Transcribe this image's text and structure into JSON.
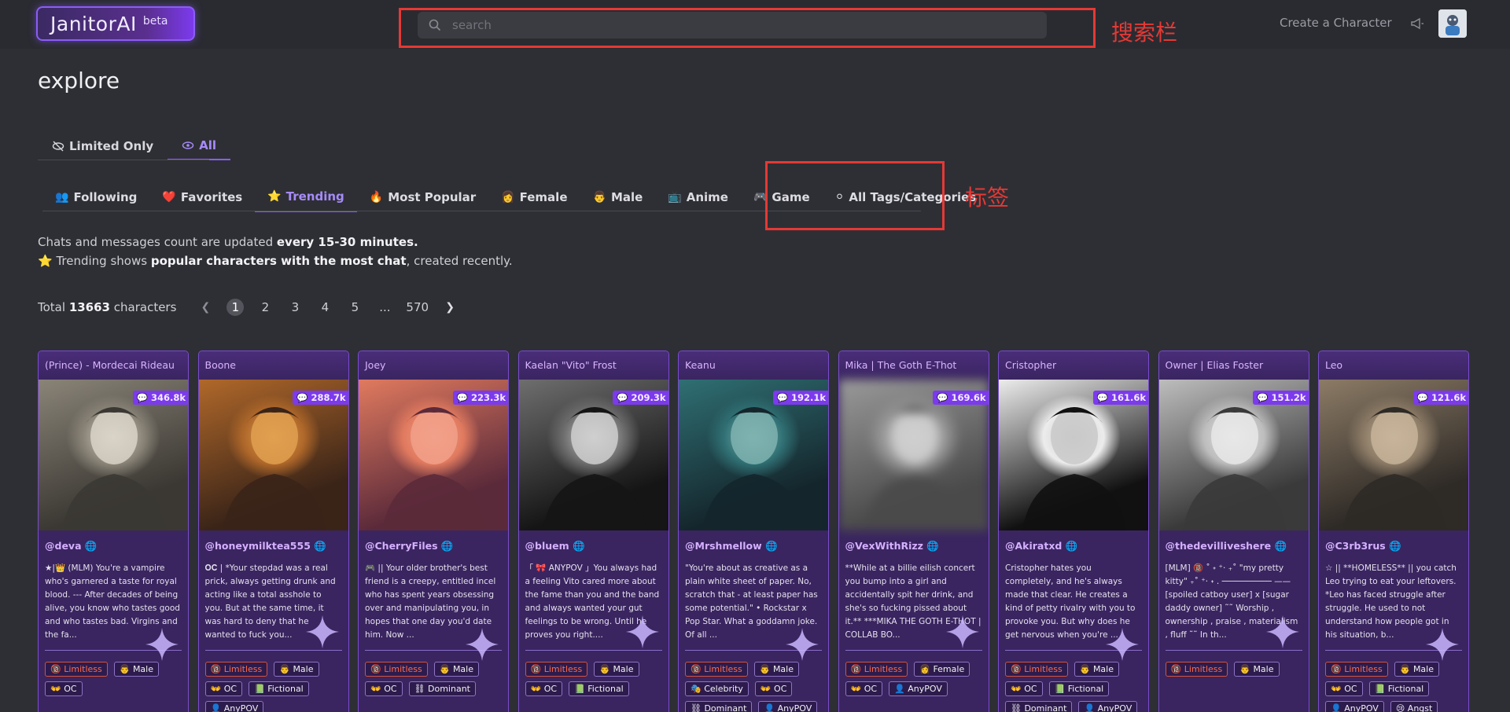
{
  "header": {
    "logo_main": "JanitorAI",
    "logo_beta": "beta",
    "search_placeholder": "search",
    "search_annotation": "搜索栏",
    "create_link": "Create a Character"
  },
  "page_title": "explore",
  "view_toggle": [
    {
      "label": "Limited Only",
      "icon": "eye-slash-icon",
      "active": false
    },
    {
      "label": "All",
      "icon": "eye-icon",
      "active": true
    }
  ],
  "tabs": [
    {
      "label": "Following",
      "icon": "👥"
    },
    {
      "label": "Favorites",
      "icon": "❤️"
    },
    {
      "label": "Trending",
      "icon": "⭐",
      "active": true
    },
    {
      "label": "Most Popular",
      "icon": "🔥"
    },
    {
      "label": "Female",
      "icon": "👩"
    },
    {
      "label": "Male",
      "icon": "👨"
    },
    {
      "label": "Anime",
      "icon": "📺"
    },
    {
      "label": "Game",
      "icon": "🎮"
    },
    {
      "label": "All Tags/Categories",
      "icon": "⚪"
    }
  ],
  "tags_annotation": "标签",
  "info": {
    "line1_prefix": "Chats and messages count are updated ",
    "line1_bold": "every 15-30 minutes.",
    "line2_star": "⭐",
    "line2_prefix": " Trending shows ",
    "line2_bold": "popular characters with the most chat",
    "line2_suffix": ", created recently."
  },
  "pagination": {
    "total_prefix": "Total ",
    "total_count": "13663",
    "total_suffix": " characters",
    "pages": [
      "1",
      "2",
      "3",
      "4",
      "5",
      "...",
      "570"
    ],
    "current": "1"
  },
  "cards": [
    {
      "name": "(Prince) - Mordecai Rideau",
      "count": "346.8k",
      "creator": "@deva",
      "desc": "★|👑 (MLM) You're a vampire who's garnered a taste for royal blood. --- After decades of being alive, you know who tastes good and who tastes bad. Virgins and the fa...",
      "tags": [
        "Limitless",
        "Male",
        "OC"
      ],
      "palette": [
        "#8a8478",
        "#3b3833",
        "#d9d4c8"
      ]
    },
    {
      "name": "Boone",
      "count": "288.7k",
      "creator": "@honeymilktea555",
      "desc": "𝐎𝐂 | *Your stepdad was a real prick, always getting drunk and acting like a total asshole to you. But at the same time, it was hard to deny that he wanted to fuck you...",
      "tags": [
        "Limitless",
        "Male",
        "OC",
        "Fictional",
        "AnyPOV"
      ],
      "palette": [
        "#b0682a",
        "#3a2418",
        "#e0a050"
      ]
    },
    {
      "name": "Joey",
      "count": "223.3k",
      "creator": "@CherryFiles",
      "desc": "🎮 || Your older brother's best friend is a creepy, entitled incel who has spent years obsessing over and manipulating you, in hopes that one day you'd date him. Now ...",
      "tags": [
        "Limitless",
        "Male",
        "OC",
        "Dominant"
      ],
      "palette": [
        "#e07a5f",
        "#5b2a3a",
        "#f2a08a"
      ]
    },
    {
      "name": "Kaelan \"Vito\" Frost",
      "count": "209.3k",
      "creator": "@bluem",
      "desc": "「 🎀 ANYPOV 」You always had a feeling Vito cared more about the fame than you and the band and always wanted your gut feelings to be wrong. Until he proves you right....",
      "tags": [
        "Limitless",
        "Male",
        "OC",
        "Fictional"
      ],
      "palette": [
        "#6e6e6e",
        "#151515",
        "#cfcfcf"
      ]
    },
    {
      "name": "Keanu",
      "count": "192.1k",
      "creator": "@Mrshmellow",
      "desc": "\"You're about as creative as a plain white sheet of paper. No, scratch that - at least paper has some potential.\" • Rockstar x Pop Star. What a goddamn joke. Of all ...",
      "tags": [
        "Limitless",
        "Male",
        "Celebrity",
        "OC",
        "Dominant",
        "AnyPOV"
      ],
      "palette": [
        "#2f6f73",
        "#14262c",
        "#7fb3b0"
      ]
    },
    {
      "name": "Mika | The Goth E-Thot",
      "count": "169.6k",
      "creator": "@VexWithRizz",
      "desc": "**While at a billie eilish concert you bump into a girl and accidentally spit her drink, and she's so fucking pissed about it.** ***MIKA THE GOTH E-THOT | COLLAB BO...",
      "tags": [
        "Limitless",
        "Female",
        "OC",
        "AnyPOV"
      ],
      "palette": [
        "#9a9a9a",
        "#4a4a4a",
        "#d0d0d0"
      ],
      "blurred": true
    },
    {
      "name": "Cristopher",
      "count": "161.6k",
      "creator": "@Akiratxd",
      "desc": "Cristopher hates you completely, and he's always made that clear. He creates a kind of petty rivalry with you to provoke you. But why does he get nervous when you're ...",
      "tags": [
        "Limitless",
        "Male",
        "OC",
        "Fictional",
        "Dominant",
        "AnyPOV"
      ],
      "palette": [
        "#ececec",
        "#111111",
        "#c9c9c9"
      ]
    },
    {
      "name": "Owner | Elias Foster",
      "count": "151.2k",
      "creator": "@thedevilliveshere",
      "desc": "[MLM] 🔞 ˚ ˖ ⁺‧ ₊˚ \"my pretty kitty\" ₊˚ ⁺‧ ˖ . ────────── —— [spoiled catboy user] x [sugar daddy owner] ˜˜ Worship , ownership , praise , materialism , fluff ˜˜ In th...",
      "tags": [
        "Limitless",
        "Male"
      ],
      "palette": [
        "#bdbdbd",
        "#3a3a3a",
        "#e8e8e8"
      ]
    },
    {
      "name": "Leo",
      "count": "121.6k",
      "creator": "@C3rb3rus",
      "desc": "☆ || **HOMELESS** || you catch Leo trying to eat your leftovers. *Leo has faced struggle after struggle. He used to not understand how people got in his situation, b...",
      "tags": [
        "Limitless",
        "Male",
        "OC",
        "Fictional",
        "AnyPOV",
        "Angst"
      ],
      "palette": [
        "#8c7b66",
        "#2e2a26",
        "#c7b49a"
      ]
    }
  ]
}
